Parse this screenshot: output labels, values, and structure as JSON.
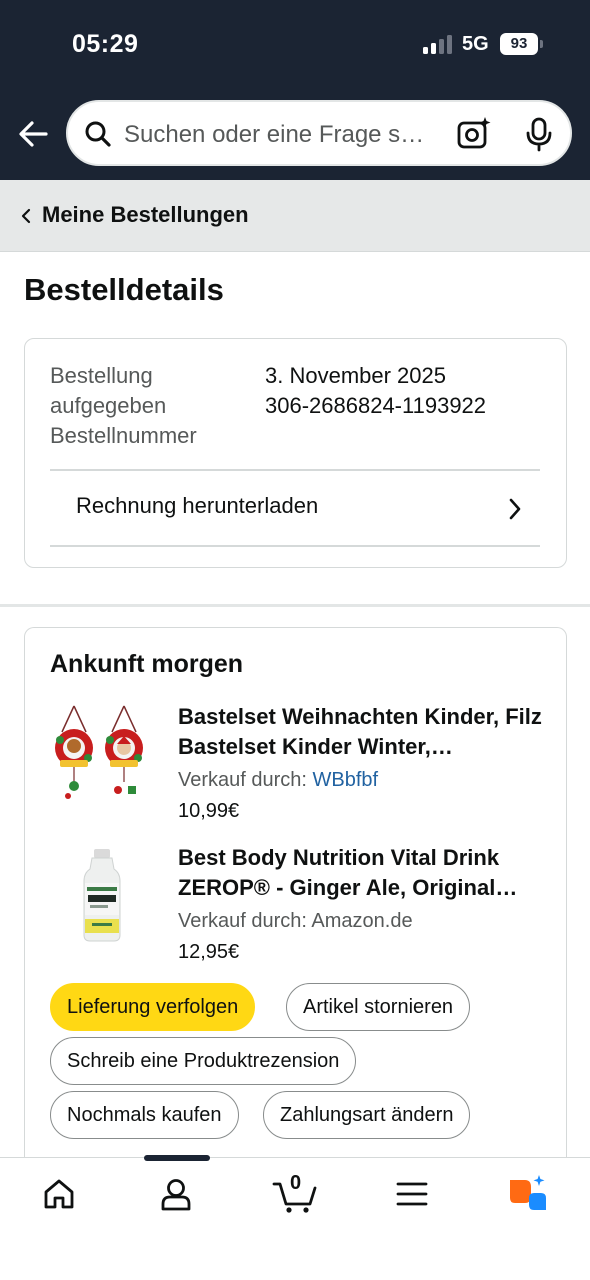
{
  "status_bar": {
    "time": "05:29",
    "network": "5G",
    "battery": "93"
  },
  "header": {
    "search_placeholder": "Suchen oder eine Frage s…"
  },
  "breadcrumb": {
    "label": "Meine Bestellungen"
  },
  "page_title": "Bestelldetails",
  "order_info": {
    "label": "Bestellung aufgegeben Bestellnummer",
    "date": "3. November 2025",
    "order_number": "306-2686824-1193922",
    "invoice_label": "Rechnung herunterladen"
  },
  "delivery": {
    "title": "Ankunft morgen",
    "items": [
      {
        "title": "Bastelset Weihnachten Kinder, Filz Bastelset Kinder Winter, Weihnachtsdeko",
        "seller_prefix": "Verkauf durch: ",
        "seller": "WBbfbf",
        "price": "10,99€",
        "thumb_icon": "christmas-wreath-craft-icon"
      },
      {
        "title": "Best Body Nutrition Vital Drink ZEROP® - Ginger Ale, Original Getränkekonzentrat",
        "seller_prefix": "Verkauf durch: ",
        "seller": "Amazon.de",
        "price": "12,95€",
        "thumb_icon": "drink-bottle-icon"
      }
    ],
    "buttons": {
      "track": "Lieferung verfolgen",
      "cancel": "Artikel stornieren",
      "review": "Schreib eine Produktrezension",
      "buy_again": "Nochmals kaufen",
      "change_payment": "Zahlungsart ändern"
    }
  },
  "bottom_nav": {
    "cart_count": "0",
    "icons": [
      "home-icon",
      "account-icon",
      "cart-icon",
      "menu-icon",
      "rufus-assistant-icon"
    ]
  },
  "colors": {
    "header_bg": "#1b2433",
    "primary_button": "#ffd814",
    "link": "#2162a1",
    "assistant_orange": "#ff6a13",
    "assistant_blue": "#1a8cff"
  }
}
